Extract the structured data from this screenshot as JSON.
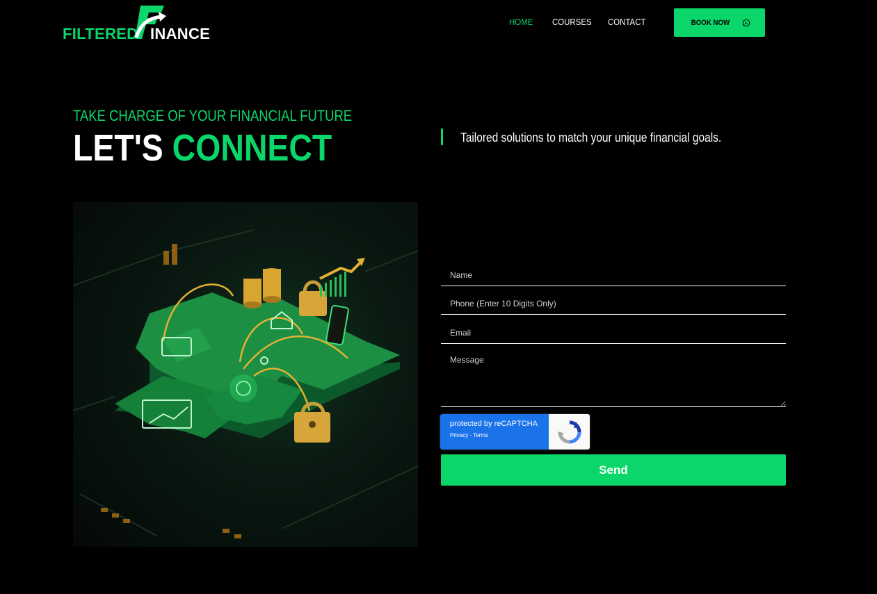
{
  "brand": {
    "logo_part1": "FILTERED",
    "logo_part2": "INANCE",
    "logo_mark_letter": "F",
    "accent_color": "#0bd66a"
  },
  "nav": {
    "items": [
      {
        "label": "HOME",
        "active": true
      },
      {
        "label": "COURSES",
        "active": false
      },
      {
        "label": "CONTACT",
        "active": false
      }
    ],
    "book_now_label": "BOOK NOW",
    "book_now_icon": "whatsapp-icon"
  },
  "hero": {
    "kicker": "TAKE CHARGE OF YOUR FINANCIAL FUTURE",
    "headline_white": "LET'S",
    "headline_green": "CONNECT",
    "tagline": "Tailored solutions to match your unique financial goals."
  },
  "form": {
    "name_placeholder": "Name",
    "phone_placeholder": "Phone (Enter 10 Digits Only)",
    "email_placeholder": "Email",
    "message_placeholder": "Message",
    "recaptcha_title": "protected by reCAPTCHA",
    "recaptcha_links": "Privacy - Terms",
    "send_label": "Send"
  }
}
